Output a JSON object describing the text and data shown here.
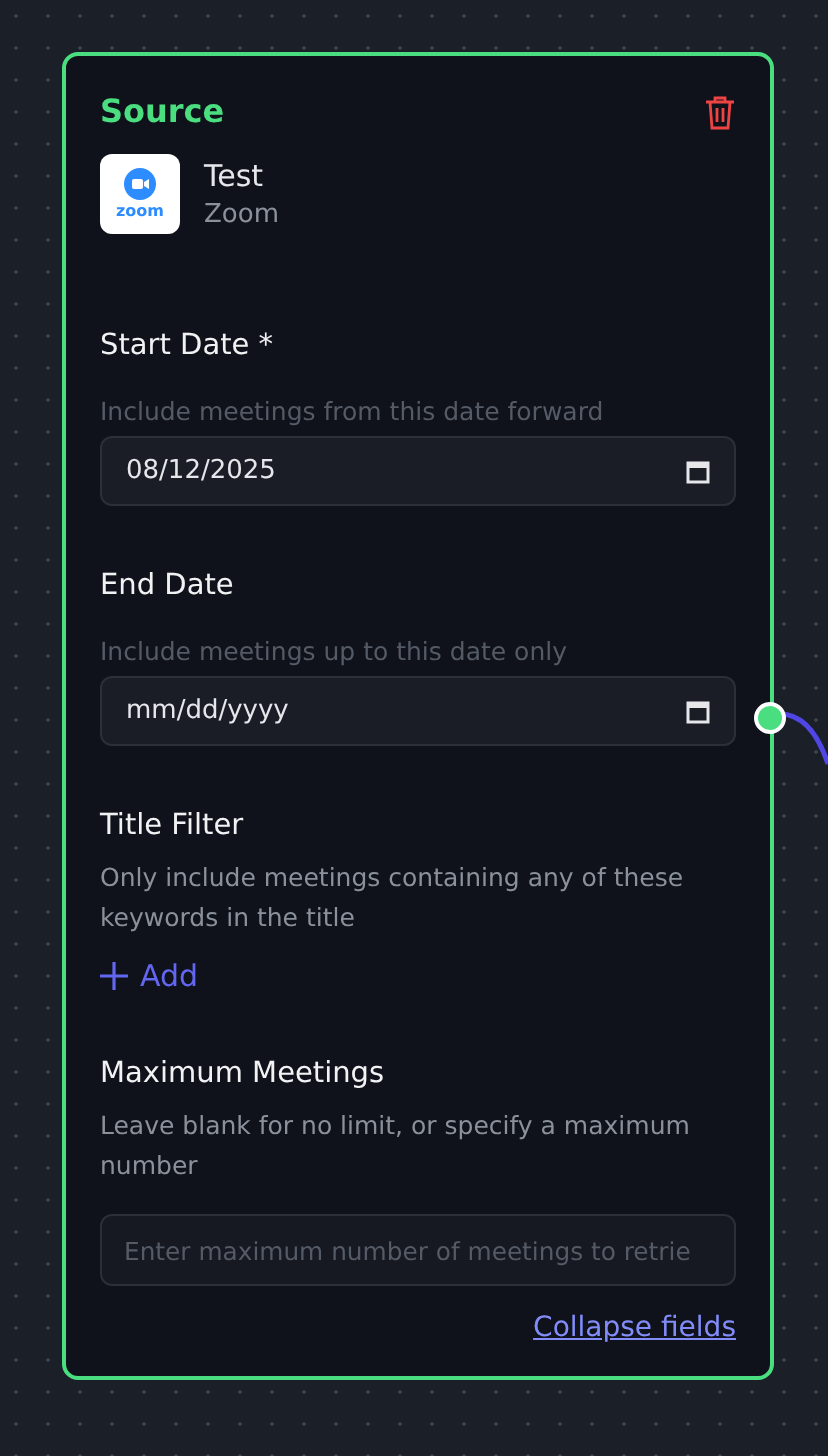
{
  "node": {
    "title": "Source",
    "source": {
      "name": "Test",
      "app": "Zoom",
      "logo_text": "zoom"
    },
    "fields": [
      {
        "kind": "date",
        "label": "Start Date *",
        "hint": "Include meetings from this date forward",
        "value": "08/12/2025"
      },
      {
        "kind": "date",
        "label": "End Date",
        "hint": "Include meetings up to this date only",
        "placeholder": "mm/dd/yyyy",
        "connector": true
      },
      {
        "kind": "list",
        "label": "Title Filter",
        "hint": "Only include meetings containing any of these keywords in the title",
        "add_label": "Add"
      },
      {
        "kind": "number",
        "label": "Maximum Meetings",
        "hint": "Leave blank for no limit, or specify a maximum number",
        "placeholder": "Enter maximum number of meetings to retrie"
      }
    ],
    "collapse_link": "Collapse fields"
  }
}
